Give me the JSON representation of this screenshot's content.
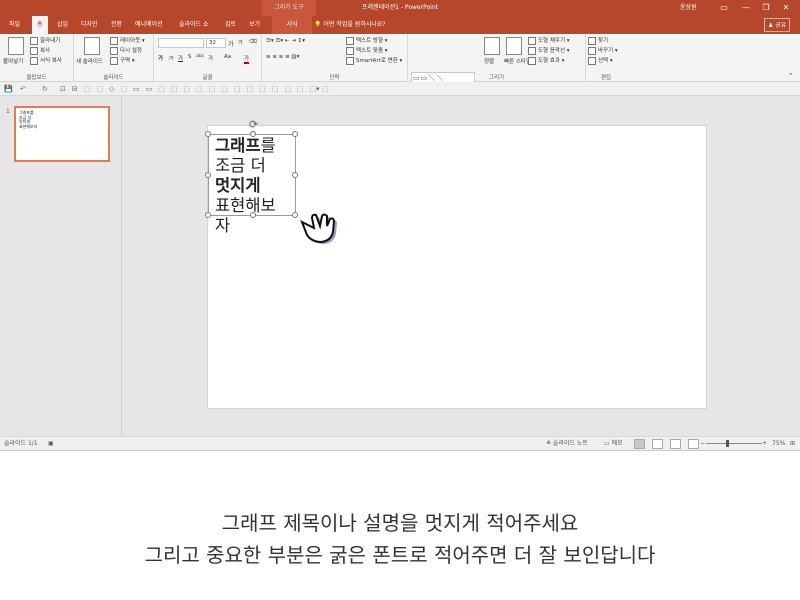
{
  "titlebar": {
    "context_tab": "그리기 도구",
    "doc_title": "프레젠테이션1 - PowerPoint",
    "user": "윤상원",
    "restore_icon": "ribbon-display-icon",
    "minimize": "—",
    "maximize": "❐",
    "close": "✕"
  },
  "tabs": {
    "file": "파일",
    "home": "홈",
    "insert": "삽입",
    "design": "디자인",
    "transitions": "전환",
    "animations": "애니메이션",
    "slideshow": "슬라이드 쇼",
    "review": "검토",
    "view": "보기",
    "format": "서식",
    "tellme": "💡 어떤 작업을 원하시나요?",
    "share": "♟ 공유"
  },
  "ribbon": {
    "clipboard": {
      "paste": "붙여넣기",
      "cut": "잘라내기",
      "copy": "복사",
      "format_painter": "서식 복사",
      "label": "클립보드"
    },
    "slides": {
      "new_slide": "새 슬라이드",
      "layout": "레이아웃 ▾",
      "reset": "다시 설정",
      "section": "구역 ▾",
      "label": "슬라이드"
    },
    "font": {
      "name": "",
      "size": "32",
      "bold": "가",
      "italic": "가",
      "underline": "가",
      "strike": "S",
      "spacing": "abc",
      "case": "가",
      "clear": "Aa",
      "color": "가",
      "grow": "가",
      "shrink": "가",
      "label": "글꼴"
    },
    "paragraph": {
      "text_direction": "텍스트 방향 ▾",
      "align_text": "텍스트 맞춤 ▾",
      "smartart": "SmartArt로 변환 ▾",
      "label": "단락"
    },
    "drawing": {
      "shapes_glyphs": "▭▭＼＼▭○▭△⌐⌐⇨⇩△↺＼⌒⌒{ }☆",
      "arrange": "정렬",
      "quick_styles": "빠른 스타일",
      "fill": "도형 채우기 ▾",
      "outline": "도형 윤곽선 ▾",
      "effects": "도형 효과 ▾",
      "label": "그리기"
    },
    "editing": {
      "find": "찾기",
      "replace": "바꾸기 ▾",
      "select": "선택 ▾",
      "label": "편집"
    }
  },
  "qat": {
    "save": "💾",
    "undo": "↶",
    "redo": "↻",
    "more": "▾"
  },
  "thumbnail": {
    "number": "1",
    "lines": [
      "그래프를",
      "조금 더",
      "멋지게",
      "표현해보자"
    ]
  },
  "slide": {
    "line1_bold": "그래프",
    "line1_rest": "를",
    "line2": "조금 더",
    "line3": "멋지게",
    "line4": "표현해보자"
  },
  "status": {
    "slide_count": "슬라이드 1/1",
    "notes": "≜ 슬라이드 노트",
    "comments": "▭ 메모",
    "zoom_minus": "−",
    "zoom_plus": "+",
    "zoom": "75%"
  },
  "caption": {
    "line1": "그래프 제목이나 설명을 멋지게 적어주세요",
    "line2": "그리고 중요한 부분은 굵은 폰트로 적어주면 더 잘 보인답니다"
  },
  "colors": {
    "accent": "#b7472a",
    "ribbon_bg": "#f4f4f4",
    "workspace": "#e6e6e6"
  }
}
